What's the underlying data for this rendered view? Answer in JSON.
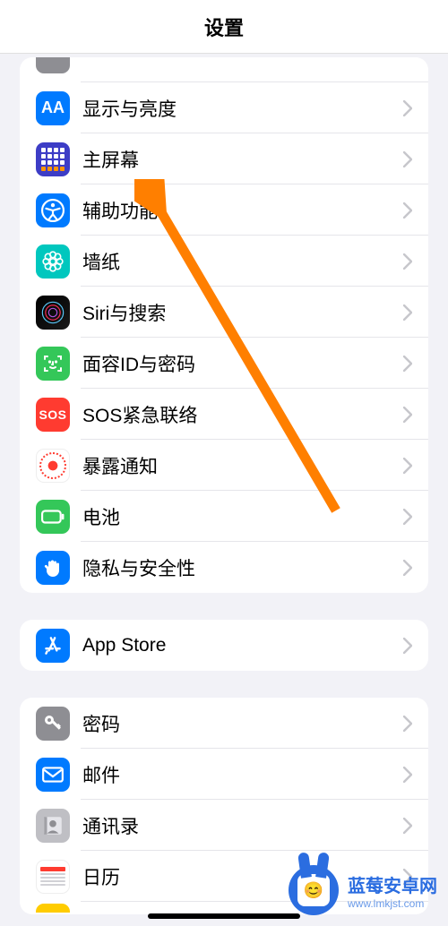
{
  "header": {
    "title": "设置"
  },
  "group1": {
    "items": [
      {
        "label": "显示与亮度"
      },
      {
        "label": "主屏幕"
      },
      {
        "label": "辅助功能"
      },
      {
        "label": "墙纸"
      },
      {
        "label": "Siri与搜索"
      },
      {
        "label": "面容ID与密码"
      },
      {
        "label": "SOS紧急联络"
      },
      {
        "label": "暴露通知"
      },
      {
        "label": "电池"
      },
      {
        "label": "隐私与安全性"
      }
    ],
    "sos_text": "SOS",
    "display_text": "AA"
  },
  "group2": {
    "items": [
      {
        "label": "App Store"
      }
    ]
  },
  "group3": {
    "items": [
      {
        "label": "密码"
      },
      {
        "label": "邮件"
      },
      {
        "label": "通讯录"
      },
      {
        "label": "日历"
      }
    ]
  },
  "watermark": {
    "line1": "蓝莓安卓网",
    "line2": "www.lmkjst.com"
  }
}
